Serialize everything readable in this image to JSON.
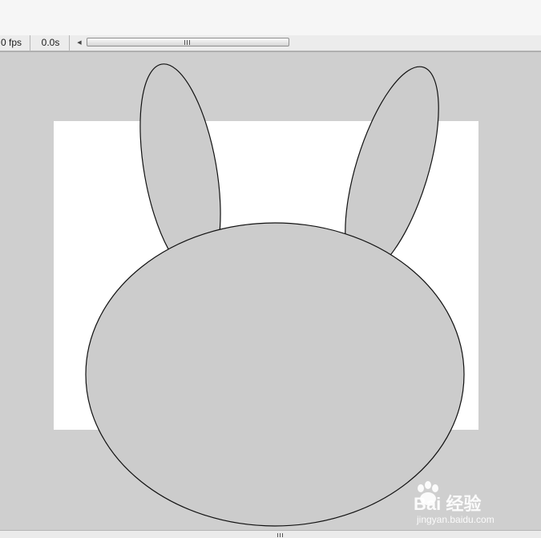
{
  "timeline": {
    "fps_label": "0 fps",
    "time_label": "0.0s",
    "scroll_left_glyph": "◀"
  },
  "stage": {
    "background_color": "#cfcfcf",
    "canvas_color": "#ffffff",
    "shape_fill": "#cccccc",
    "shape_stroke": "#111111"
  },
  "watermark": {
    "brand_text": "Bai  经验",
    "url_text": "jingyan.baidu.com"
  }
}
